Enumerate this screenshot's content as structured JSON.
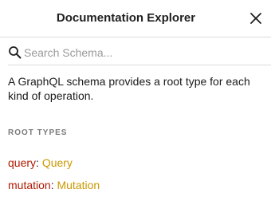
{
  "header": {
    "title": "Documentation Explorer",
    "close_icon": "close-icon"
  },
  "search": {
    "placeholder": "Search Schema...",
    "value": "",
    "icon": "search-icon"
  },
  "description": "A GraphQL schema provides a root type for each kind of operation.",
  "root_types": {
    "section_title": "ROOT TYPES",
    "items": [
      {
        "field": "query",
        "separator": ": ",
        "type": "Query"
      },
      {
        "field": "mutation",
        "separator": ": ",
        "type": "Mutation"
      }
    ]
  },
  "colors": {
    "field": "#b11a04",
    "type": "#ca9800",
    "section_title": "#7a7a7a",
    "divider": "#dcdcdc"
  }
}
